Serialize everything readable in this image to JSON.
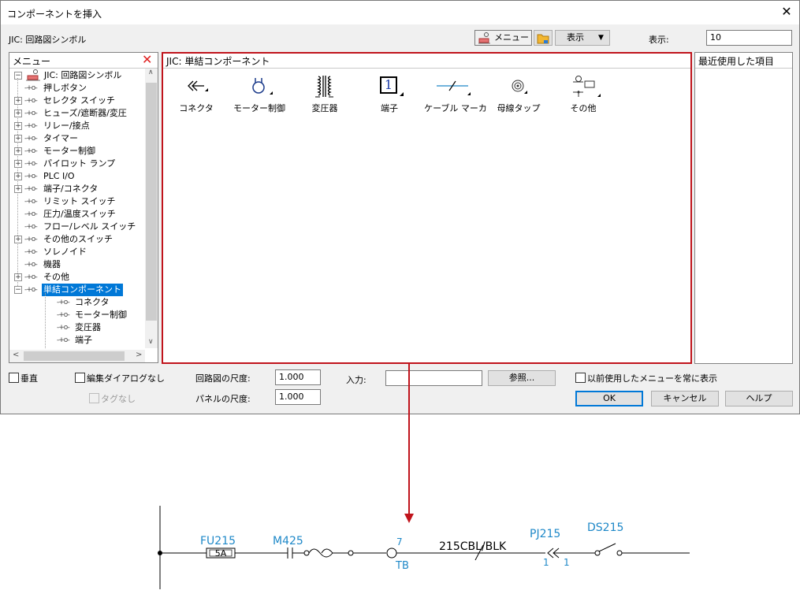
{
  "window": {
    "title": "コンポーネントを挿入",
    "close_glyph": "✕"
  },
  "toolbar": {
    "library_label": "JIC: 回路図シンボル",
    "menu_button": "メニュー",
    "view_button": "表示",
    "display_label": "表示:",
    "display_value": "10"
  },
  "menu_panel": {
    "title": "メニュー",
    "close_glyph": "✕",
    "root": "JIC: 回路図シンボル",
    "items": [
      {
        "label": "押しボタン",
        "expandable": false
      },
      {
        "label": "セレクタ スイッチ",
        "expandable": true
      },
      {
        "label": "ヒューズ/遮断器/変圧",
        "expandable": true
      },
      {
        "label": "リレー/接点",
        "expandable": true
      },
      {
        "label": "タイマー",
        "expandable": true
      },
      {
        "label": "モーター制御",
        "expandable": true
      },
      {
        "label": "パイロット ランプ",
        "expandable": true
      },
      {
        "label": "PLC I/O",
        "expandable": true
      },
      {
        "label": "端子/コネクタ",
        "expandable": true
      },
      {
        "label": "リミット スイッチ",
        "expandable": false
      },
      {
        "label": "圧力/温度スイッチ",
        "expandable": false
      },
      {
        "label": "フロー/レベル スイッチ",
        "expandable": false
      },
      {
        "label": "その他のスイッチ",
        "expandable": true
      },
      {
        "label": "ソレノイド",
        "expandable": false
      },
      {
        "label": "機器",
        "expandable": false
      },
      {
        "label": "その他",
        "expandable": true
      },
      {
        "label": "単結コンポーネント",
        "expandable": true,
        "expanded": true,
        "selected": true
      }
    ],
    "children": [
      "コネクタ",
      "モーター制御",
      "変圧器",
      "端子"
    ],
    "node_glyph": "-+o-"
  },
  "main_panel": {
    "title": "JIC: 単結コンポーネント",
    "components": [
      {
        "label": "コネクタ",
        "icon": "connector-icon"
      },
      {
        "label": "モーター制御",
        "icon": "motor-control-icon"
      },
      {
        "label": "変圧器",
        "icon": "transformer-icon"
      },
      {
        "label": "端子",
        "icon": "terminal-icon",
        "glyph": "1"
      },
      {
        "label": "ケーブル マーカ",
        "icon": "cable-marker-icon"
      },
      {
        "label": "母線タップ",
        "icon": "bus-tap-icon"
      },
      {
        "label": "その他",
        "icon": "misc-icon"
      }
    ]
  },
  "recent_panel": {
    "title": "最近使用した項目"
  },
  "options": {
    "vertical": "垂直",
    "no_edit_dialog": "編集ダイアログなし",
    "no_tag": "タグなし",
    "schematic_scale_label": "回路図の尺度:",
    "schematic_scale_value": "1.000",
    "panel_scale_label": "パネルの尺度:",
    "panel_scale_value": "1.000",
    "input_label": "入力:",
    "input_value": "",
    "browse_button": "参照...",
    "always_show_previous": "以前使用したメニューを常に表示"
  },
  "buttons": {
    "ok": "OK",
    "cancel": "キャンセル",
    "help": "ヘルプ"
  },
  "schematic": {
    "fuse_tag": "FU215",
    "fuse_rating": "5A",
    "contact_tag": "M425",
    "terminal_number": "7",
    "terminal_tag": "TB",
    "cable_tag": "215CBL/BLK",
    "connector_tag": "PJ215",
    "connector_pin_left": "1",
    "connector_pin_right": "1",
    "switch_tag": "DS215",
    "accent_color": "#1e88c8",
    "arrow_color": "#c0141c"
  }
}
